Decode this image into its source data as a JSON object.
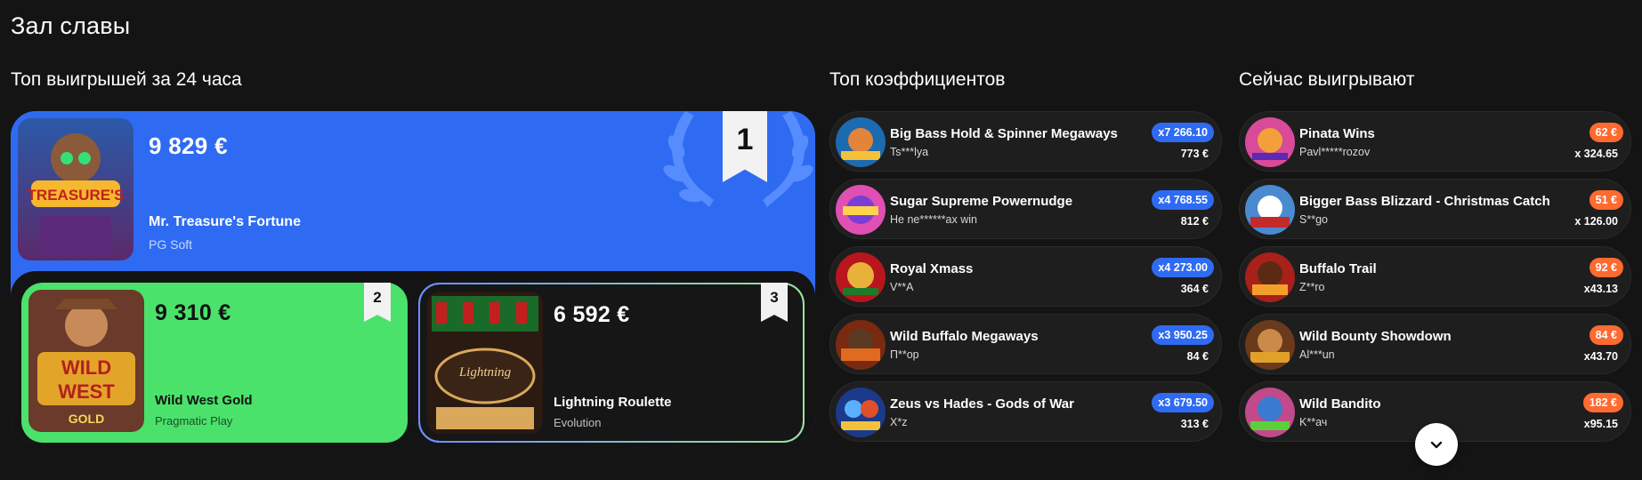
{
  "page_title": "Зал славы",
  "sections": {
    "top_wins_title": "Топ выигрышей за 24 часа",
    "top_coef_title": "Топ коэффициентов",
    "now_winning_title": "Сейчас выигрывают"
  },
  "top_wins": [
    {
      "rank": "1",
      "amount": "9 829 €",
      "game": "Mr. Treasure's Fortune",
      "provider": "PG Soft",
      "thumb_text": "TREASURE'S",
      "colors": {
        "bg": "#2f6bf2"
      }
    },
    {
      "rank": "2",
      "amount": "9 310 €",
      "game": "Wild West Gold",
      "provider": "Pragmatic Play",
      "thumb_text": "WILD WEST",
      "colors": {
        "bg": "#4ae26a"
      }
    },
    {
      "rank": "3",
      "amount": "6 592 €",
      "game": "Lightning Roulette",
      "provider": "Evolution",
      "thumb_text": "LIGHTNING",
      "colors": {
        "bg": "#161616"
      }
    }
  ],
  "top_coefficients": [
    {
      "game": "Big Bass Hold & Spinner Megaways",
      "user": "Ts***lya",
      "coef": "x7 266.10",
      "amount": "773 €",
      "icon": "game-thumb-icon"
    },
    {
      "game": "Sugar Supreme Powernudge",
      "user": "He ne******ax win",
      "coef": "x4 768.55",
      "amount": "812 €",
      "icon": "game-thumb-icon"
    },
    {
      "game": "Royal Xmass",
      "user": "V**A",
      "coef": "x4 273.00",
      "amount": "364 €",
      "icon": "game-thumb-icon"
    },
    {
      "game": "Wild Buffalo Megaways",
      "user": "П**ор",
      "coef": "x3 950.25",
      "amount": "84 €",
      "icon": "game-thumb-icon"
    },
    {
      "game": "Zeus vs Hades - Gods of War",
      "user": "X*z",
      "coef": "x3 679.50",
      "amount": "313 €",
      "icon": "game-thumb-icon"
    }
  ],
  "now_winning": [
    {
      "game": "Pinata Wins",
      "user": "Pavl*****rozov",
      "amount": "62 €",
      "coef": "x 324.65"
    },
    {
      "game": "Bigger Bass Blizzard - Christmas Catch",
      "user": "S**go",
      "amount": "51 €",
      "coef": "x 126.00"
    },
    {
      "game": "Buffalo Trail",
      "user": "Z**ro",
      "amount": "92 €",
      "coef": "x43.13"
    },
    {
      "game": "Wild Bounty Showdown",
      "user": "Al***un",
      "amount": "84 €",
      "coef": "x43.70"
    },
    {
      "game": "Wild Bandito",
      "user": "K**ач",
      "amount": "182 €",
      "coef": "x95.15"
    }
  ],
  "colors": {
    "accent_blue": "#2f6bf2",
    "accent_green": "#4ae26a",
    "accent_orange": "#ff6a30",
    "background": "#141414"
  }
}
